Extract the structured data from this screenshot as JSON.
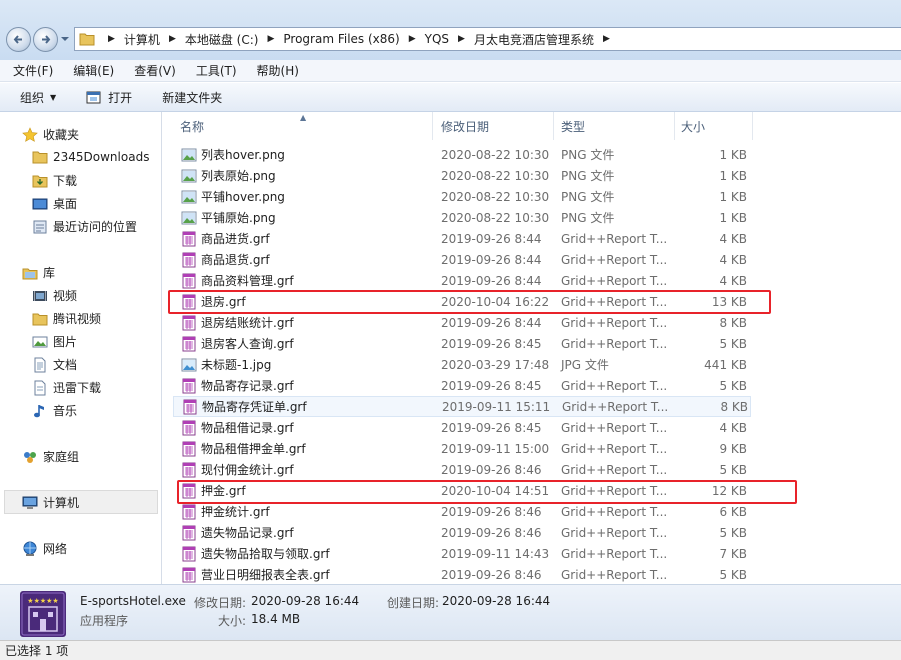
{
  "address": {
    "crumbs": [
      "计算机",
      "本地磁盘 (C:)",
      "Program Files (x86)",
      "YQS",
      "月太电竞酒店管理系统"
    ]
  },
  "menu": [
    "文件(F)",
    "编辑(E)",
    "查看(V)",
    "工具(T)",
    "帮助(H)"
  ],
  "toolbar": {
    "organize": "组织",
    "open": "打开",
    "new_folder": "新建文件夹"
  },
  "nav": {
    "favorites": "收藏夹",
    "fav_items": [
      "2345Downloads",
      "下载",
      "桌面",
      "最近访问的位置"
    ],
    "libraries": "库",
    "lib_items": [
      "视频",
      "腾讯视频",
      "图片",
      "文档",
      "迅雷下载",
      "音乐"
    ],
    "homegroup": "家庭组",
    "computer": "计算机",
    "network": "网络"
  },
  "columns": {
    "name": "名称",
    "date": "修改日期",
    "type": "类型",
    "size": "大小"
  },
  "files": [
    {
      "name": "列表hover.png",
      "date": "2020-08-22 10:30",
      "type": "PNG 文件",
      "size": "1 KB",
      "icon": "png"
    },
    {
      "name": "列表原始.png",
      "date": "2020-08-22 10:30",
      "type": "PNG 文件",
      "size": "1 KB",
      "icon": "png"
    },
    {
      "name": "平铺hover.png",
      "date": "2020-08-22 10:30",
      "type": "PNG 文件",
      "size": "1 KB",
      "icon": "png"
    },
    {
      "name": "平铺原始.png",
      "date": "2020-08-22 10:30",
      "type": "PNG 文件",
      "size": "1 KB",
      "icon": "png"
    },
    {
      "name": "商品进货.grf",
      "date": "2019-09-26 8:44",
      "type": "Grid++Report T...",
      "size": "4 KB",
      "icon": "grf"
    },
    {
      "name": "商品退货.grf",
      "date": "2019-09-26 8:44",
      "type": "Grid++Report T...",
      "size": "4 KB",
      "icon": "grf"
    },
    {
      "name": "商品资料管理.grf",
      "date": "2019-09-26 8:44",
      "type": "Grid++Report T...",
      "size": "4 KB",
      "icon": "grf"
    },
    {
      "name": "退房.grf",
      "date": "2020-10-04 16:22",
      "type": "Grid++Report T...",
      "size": "13 KB",
      "icon": "grf"
    },
    {
      "name": "退房结账统计.grf",
      "date": "2019-09-26 8:44",
      "type": "Grid++Report T...",
      "size": "8 KB",
      "icon": "grf"
    },
    {
      "name": "退房客人查询.grf",
      "date": "2019-09-26 8:45",
      "type": "Grid++Report T...",
      "size": "5 KB",
      "icon": "grf"
    },
    {
      "name": "未标题-1.jpg",
      "date": "2020-03-29 17:48",
      "type": "JPG 文件",
      "size": "441 KB",
      "icon": "jpg"
    },
    {
      "name": "物品寄存记录.grf",
      "date": "2019-09-26 8:45",
      "type": "Grid++Report T...",
      "size": "5 KB",
      "icon": "grf"
    },
    {
      "name": "物品寄存凭证单.grf",
      "date": "2019-09-11 15:11",
      "type": "Grid++Report T...",
      "size": "8 KB",
      "icon": "grf"
    },
    {
      "name": "物品租借记录.grf",
      "date": "2019-09-26 8:45",
      "type": "Grid++Report T...",
      "size": "4 KB",
      "icon": "grf"
    },
    {
      "name": "物品租借押金单.grf",
      "date": "2019-09-11 15:00",
      "type": "Grid++Report T...",
      "size": "9 KB",
      "icon": "grf"
    },
    {
      "name": "现付佣金统计.grf",
      "date": "2019-09-26 8:46",
      "type": "Grid++Report T...",
      "size": "5 KB",
      "icon": "grf"
    },
    {
      "name": "押金.grf",
      "date": "2020-10-04 14:51",
      "type": "Grid++Report T...",
      "size": "12 KB",
      "icon": "grf"
    },
    {
      "name": "押金统计.grf",
      "date": "2019-09-26 8:46",
      "type": "Grid++Report T...",
      "size": "6 KB",
      "icon": "grf"
    },
    {
      "name": "遗失物品记录.grf",
      "date": "2019-09-26 8:46",
      "type": "Grid++Report T...",
      "size": "5 KB",
      "icon": "grf"
    },
    {
      "name": "遗失物品拾取与领取.grf",
      "date": "2019-09-11 14:43",
      "type": "Grid++Report T...",
      "size": "7 KB",
      "icon": "grf"
    },
    {
      "name": "营业日明细报表全表.grf",
      "date": "2019-09-26 8:46",
      "type": "Grid++Report T...",
      "size": "5 KB",
      "icon": "grf"
    }
  ],
  "details": {
    "filename": "E-sportsHotel.exe",
    "filetype": "应用程序",
    "modified_label": "修改日期:",
    "modified": "2020-09-28 16:44",
    "created_label": "创建日期:",
    "created": "2020-09-28 16:44",
    "size_label": "大小:",
    "size": "18.4 MB"
  },
  "status": "已选择 1 项",
  "colors": {
    "highlight": "#e8232a",
    "grf_icon": "#b03fb5",
    "app_icon_bg": "#4a2a7a"
  }
}
